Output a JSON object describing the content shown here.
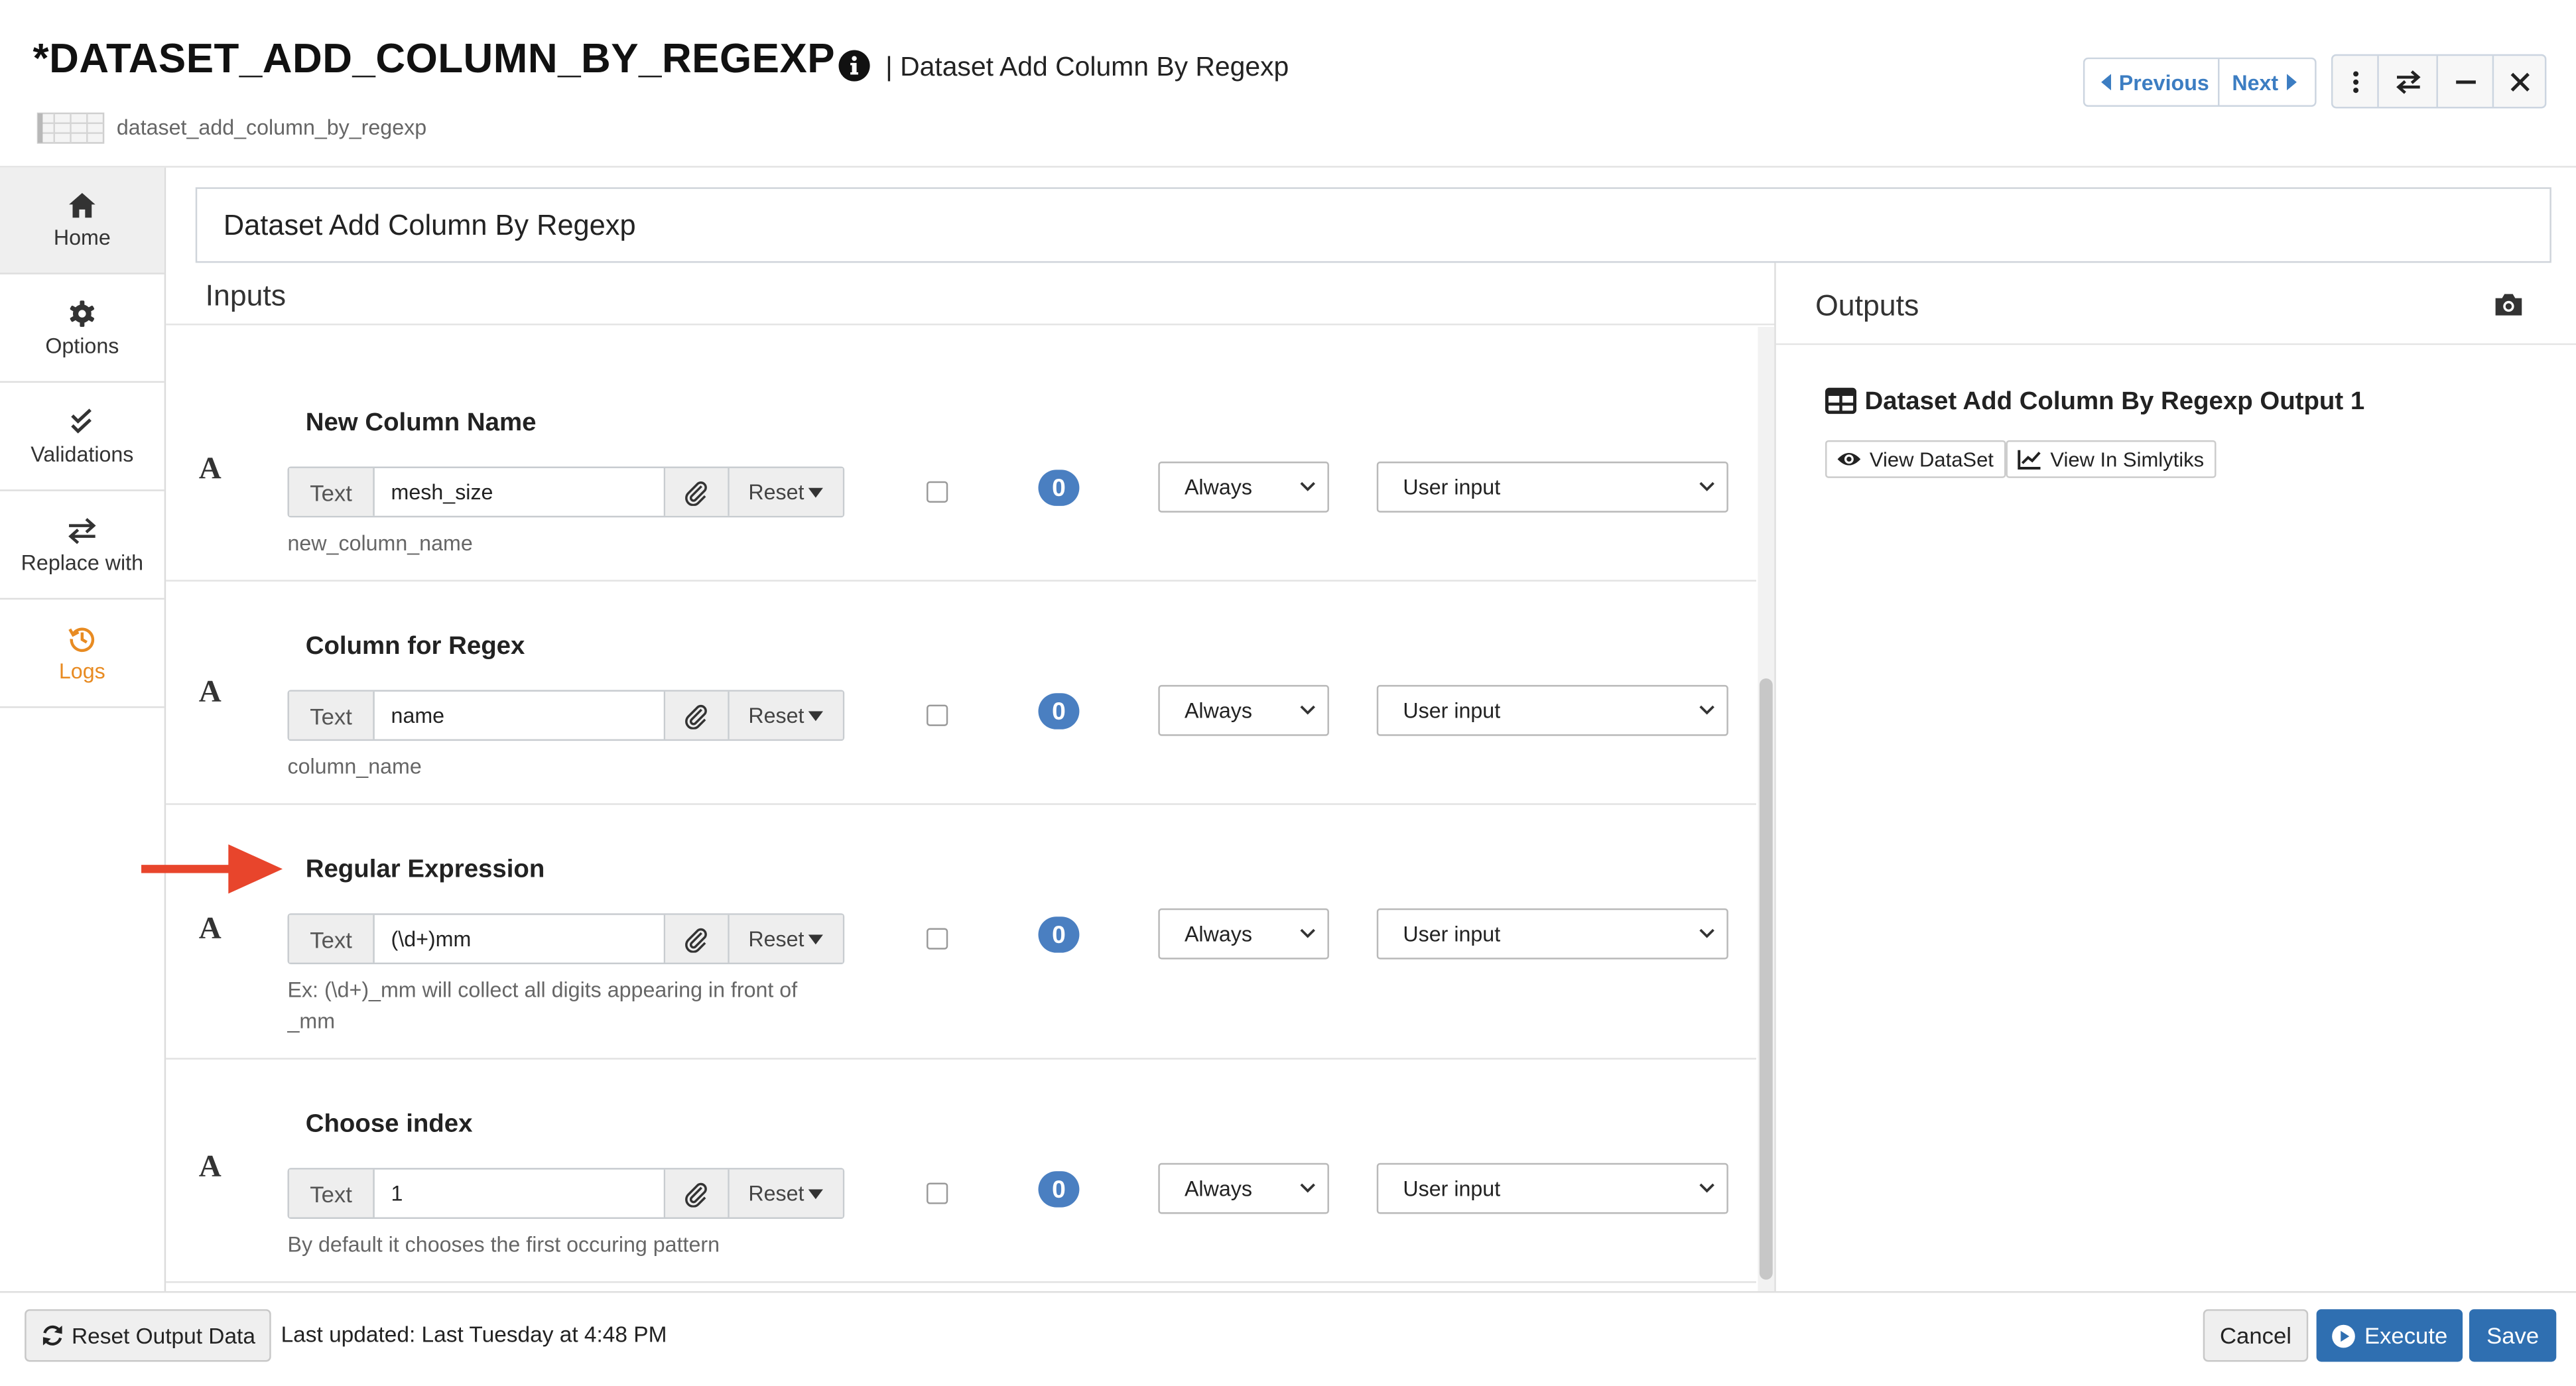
{
  "header": {
    "title": "*DATASET_ADD_COLUMN_BY_REGEXP",
    "subtitle": "| Dataset Add Column By Regexp",
    "file_name": "dataset_add_column_by_regexp",
    "info_icon": "info-icon",
    "nav": {
      "previous_label": "Previous",
      "next_label": "Next"
    },
    "window_icons": [
      "more-vertical-icon",
      "swap-icon",
      "minimize-icon",
      "close-icon"
    ]
  },
  "sidebar": {
    "items": [
      {
        "label": "Home",
        "icon": "home-icon"
      },
      {
        "label": "Options",
        "icon": "gear-icon"
      },
      {
        "label": "Validations",
        "icon": "double-check-icon"
      },
      {
        "label": "Replace with",
        "icon": "swap-icon"
      },
      {
        "label": "Logs",
        "icon": "history-icon"
      }
    ],
    "active_color": "#e88b22"
  },
  "name_field": {
    "value": "Dataset Add Column By Regexp"
  },
  "inputs": {
    "heading": "Inputs",
    "params": [
      {
        "title": "New Column Name",
        "type_glyph": "A",
        "type_label": "Text",
        "value": "mesh_size",
        "reset_label": "Reset",
        "help": "new_column_name",
        "count": "0",
        "condition": "Always",
        "mode": "User input",
        "checked": false
      },
      {
        "title": "Column for Regex",
        "type_glyph": "A",
        "type_label": "Text",
        "value": "name",
        "reset_label": "Reset",
        "help": "column_name",
        "count": "0",
        "condition": "Always",
        "mode": "User input",
        "checked": false
      },
      {
        "title": "Regular Expression",
        "type_glyph": "A",
        "type_label": "Text",
        "value": "(\\d+)mm",
        "reset_label": "Reset",
        "help": "Ex: (\\d+)_mm will collect all digits appearing in front of _mm",
        "count": "0",
        "condition": "Always",
        "mode": "User input",
        "checked": false
      },
      {
        "title": "Choose index",
        "type_glyph": "A",
        "type_label": "Text",
        "value": "1",
        "reset_label": "Reset",
        "help": "By default it chooses the first occuring pattern",
        "count": "0",
        "condition": "Always",
        "mode": "User input",
        "checked": false
      }
    ]
  },
  "outputs": {
    "heading": "Outputs",
    "items": [
      {
        "title": "Dataset Add Column By Regexp Output 1",
        "view_dataset_label": "View DataSet",
        "view_simlytiks_label": "View In Simlytiks"
      }
    ]
  },
  "footer": {
    "reset_output_label": "Reset Output Data",
    "last_updated": "Last updated: Last Tuesday at 4:48 PM",
    "cancel_label": "Cancel",
    "execute_label": "Execute",
    "save_label": "Save"
  },
  "colors": {
    "accent_blue": "#2f6fb1",
    "badge_blue": "#4a7fc1",
    "link_blue": "#3c7dc2",
    "annotation_arrow": "#e8452c"
  }
}
